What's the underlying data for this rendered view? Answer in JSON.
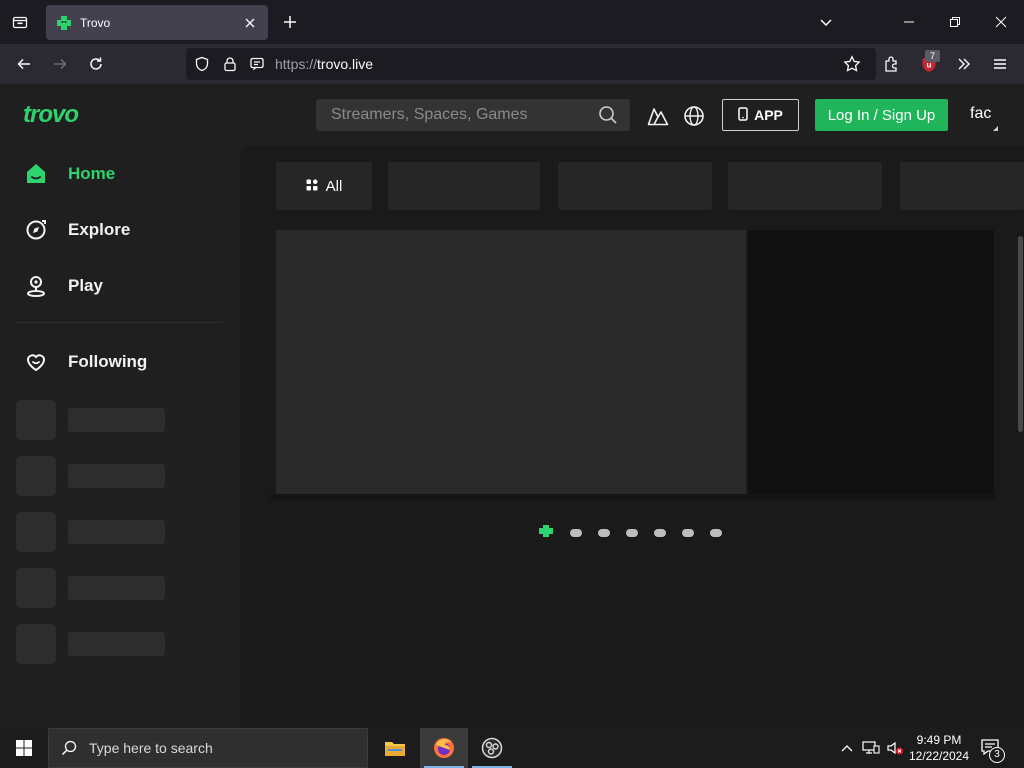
{
  "browser": {
    "tab": {
      "title": "Trovo",
      "favicon": "trovo-favicon"
    },
    "url": {
      "protocol": "https://",
      "host": "trovo.live"
    },
    "extension_badge": "7",
    "icons": [
      "tab-list-icon",
      "close-tab-icon",
      "new-tab-icon",
      "list-all-tabs-icon",
      "minimize-icon",
      "restore-icon",
      "close-window-icon",
      "back-icon",
      "forward-icon",
      "reload-icon",
      "shield-icon",
      "lock-icon",
      "permissions-icon",
      "bookmark-star-icon",
      "extensions-icon",
      "ublock-icon",
      "overflow-chevrons-icon",
      "hamburger-menu-icon"
    ]
  },
  "site": {
    "logo_text": "trovo",
    "search": {
      "placeholder": "Streamers, Spaces, Games"
    },
    "app_button": "APP",
    "login_button": "Log In / Sign Up",
    "language_label": "fac",
    "accent_color": "#20b55b"
  },
  "sidebar": {
    "items": [
      {
        "label": "Home",
        "icon": "home-icon",
        "active": true
      },
      {
        "label": "Explore",
        "icon": "explore-icon",
        "active": false
      },
      {
        "label": "Play",
        "icon": "play-pin-icon",
        "active": false
      }
    ],
    "following_label": "Following",
    "following_icon": "heart-icon",
    "skeleton_rows": 5
  },
  "main": {
    "categories": [
      "All",
      "",
      "",
      "",
      ""
    ],
    "carousel_dots": 7,
    "carousel_active_index": 0
  },
  "taskbar": {
    "search_placeholder": "Type here to search",
    "time": "9:49 PM",
    "date": "12/22/2024",
    "notification_count": "3"
  }
}
